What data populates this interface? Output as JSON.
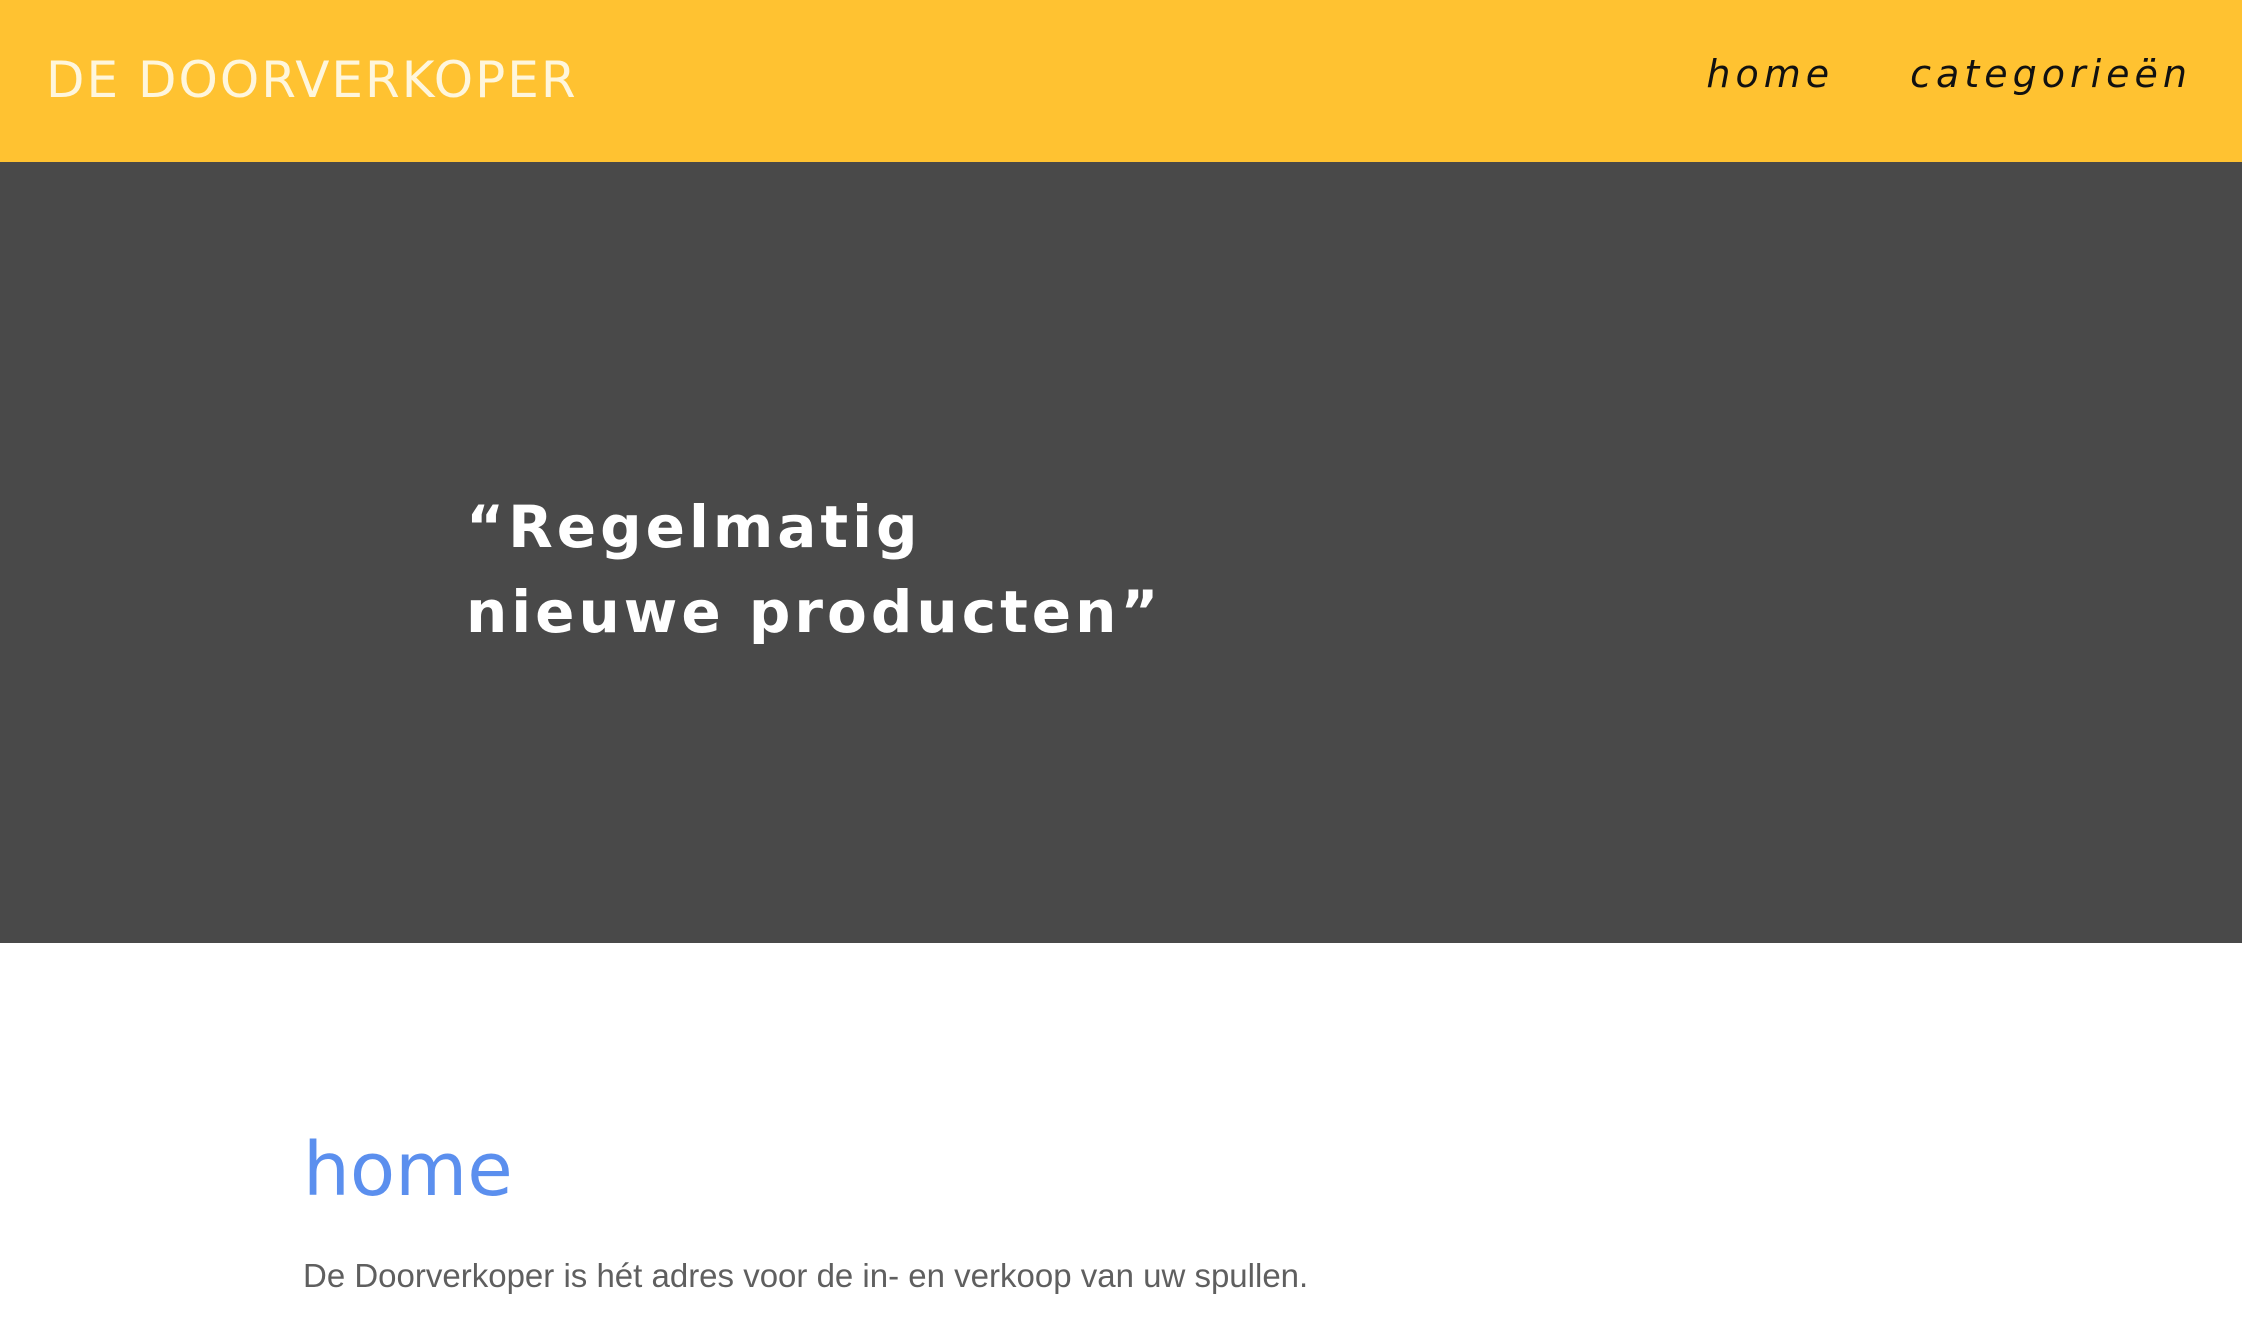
{
  "header": {
    "brand": "DE DOORVERKOPER",
    "nav": [
      {
        "label": "home"
      },
      {
        "label": "categorieën"
      }
    ]
  },
  "hero": {
    "quote_line_1": "“Regelmatig",
    "quote_line_2": "nieuwe producten”"
  },
  "main": {
    "heading": "home",
    "intro": "De Doorverkoper is hét adres voor de in- en verkoop van uw spullen."
  },
  "colors": {
    "header_bg": "#FFC231",
    "hero_bg": "#494949",
    "heading_accent": "#5B8FEE",
    "body_text": "#5f5f5f"
  }
}
